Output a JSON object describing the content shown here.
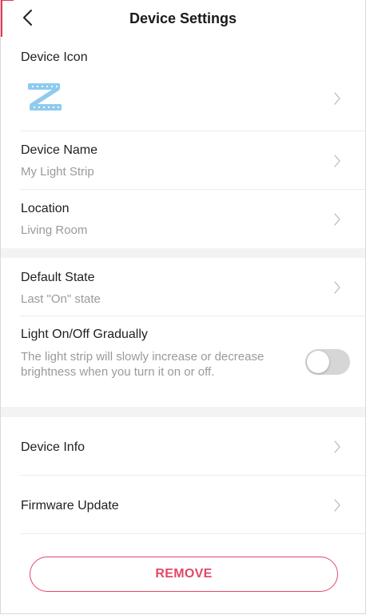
{
  "header": {
    "title": "Device Settings",
    "back_icon": "chevron-left-icon"
  },
  "device_icon": {
    "label": "Device Icon",
    "icon": "light-strip-z-icon",
    "icon_color": "#8ecbee"
  },
  "device_name": {
    "label": "Device Name",
    "value": "My Light Strip"
  },
  "location": {
    "label": "Location",
    "value": "Living Room"
  },
  "default_state": {
    "label": "Default State",
    "value": "Last \"On\" state"
  },
  "gradual": {
    "label": "Light On/Off Gradually",
    "description": "The light strip will slowly increase or decrease brightness when you turn it on or off.",
    "enabled": false
  },
  "device_info": {
    "label": "Device Info"
  },
  "firmware": {
    "label": "Firmware Update"
  },
  "remove": {
    "label": "REMOVE",
    "color": "#e0486a"
  }
}
